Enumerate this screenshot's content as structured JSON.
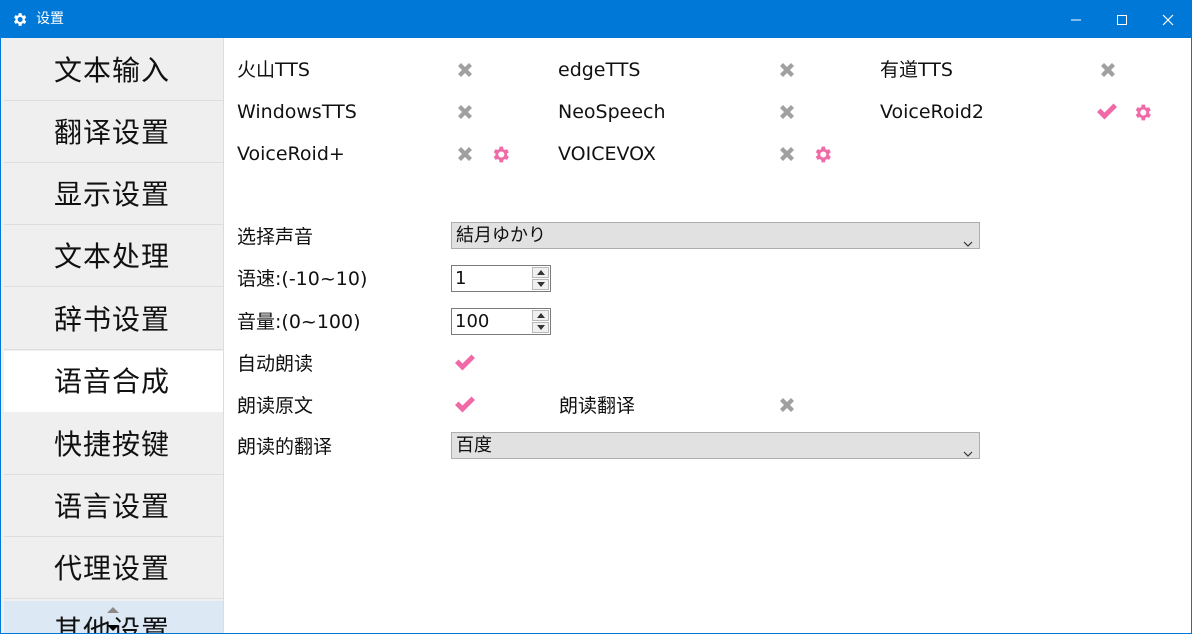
{
  "window": {
    "title": "设置"
  },
  "colors": {
    "titlebar": "#0078d7",
    "check_pink": "#f06aa8",
    "gear_pink": "#f06aa8",
    "cross_gray": "#a0a0a0"
  },
  "sidebar": {
    "items": [
      {
        "label": "文本输入"
      },
      {
        "label": "翻译设置"
      },
      {
        "label": "显示设置"
      },
      {
        "label": "文本处理"
      },
      {
        "label": "辞书设置"
      },
      {
        "label": "语音合成",
        "active": true
      },
      {
        "label": "快捷按键"
      },
      {
        "label": "语言设置"
      },
      {
        "label": "代理设置"
      },
      {
        "label": "其他设置"
      }
    ]
  },
  "engines": [
    {
      "label": "火山TTS",
      "enabled": false,
      "has_settings": false
    },
    {
      "label": "edgeTTS",
      "enabled": false,
      "has_settings": false
    },
    {
      "label": "有道TTS",
      "enabled": false,
      "has_settings": false
    },
    {
      "label": "WindowsTTS",
      "enabled": false,
      "has_settings": false
    },
    {
      "label": "NeoSpeech",
      "enabled": false,
      "has_settings": false
    },
    {
      "label": "VoiceRoid2",
      "enabled": true,
      "has_settings": true
    },
    {
      "label": "VoiceRoid+",
      "enabled": false,
      "has_settings": true
    },
    {
      "label": "VOICEVOX",
      "enabled": false,
      "has_settings": true
    }
  ],
  "settings": {
    "voice_label": "选择声音",
    "voice_value": "結月ゆかり",
    "speed_label": "语速:(-10~10)",
    "speed_value": "1",
    "volume_label": "音量:(0~100)",
    "volume_value": "100",
    "auto_read_label": "自动朗读",
    "auto_read": true,
    "read_original_label": "朗读原文",
    "read_original": true,
    "read_translation_label": "朗读翻译",
    "read_translation": false,
    "translation_source_label": "朗读的翻译",
    "translation_source_value": "百度"
  },
  "icons": {
    "app": "gear-icon",
    "enabled": "check-icon",
    "disabled": "cross-icon",
    "settings": "gear-icon"
  }
}
